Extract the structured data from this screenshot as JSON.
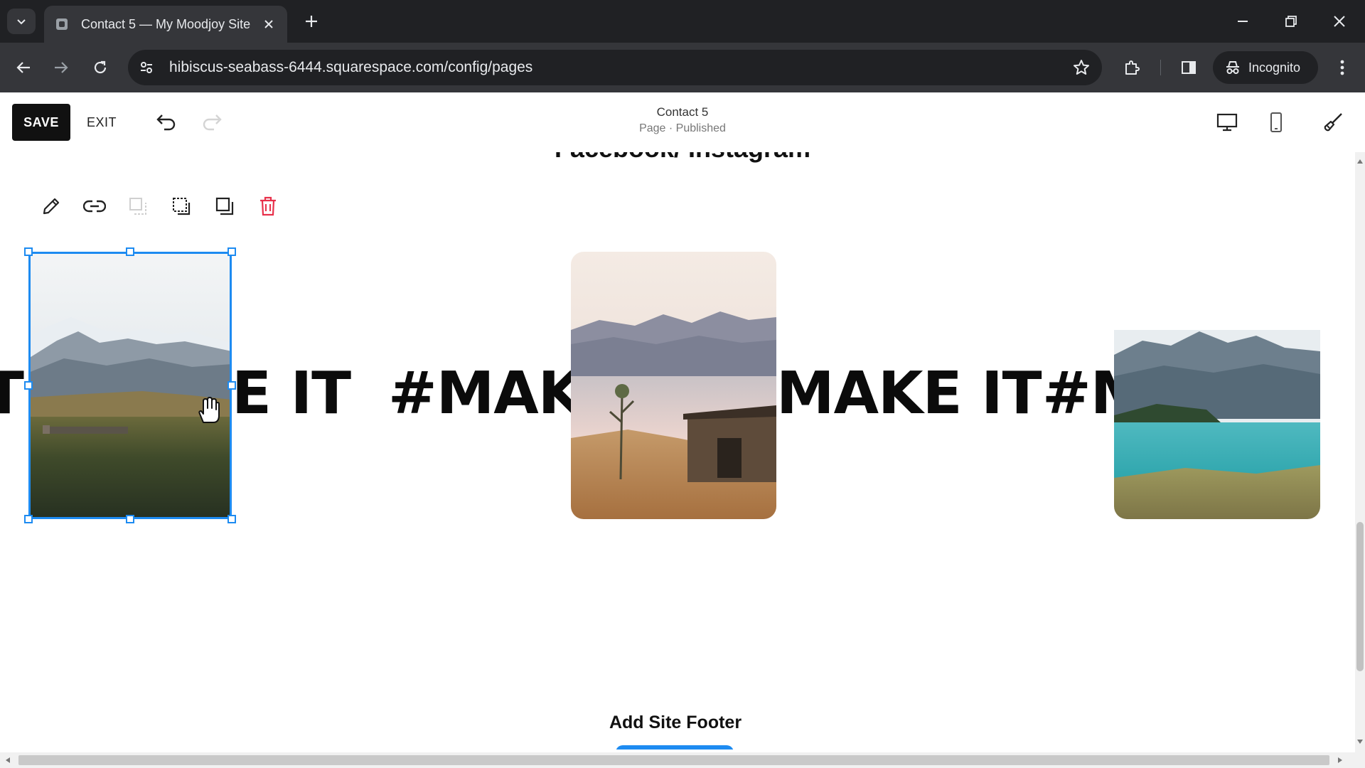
{
  "browser": {
    "tab_title": "Contact 5 — My Moodjoy Site",
    "url": "hibiscus-seabass-6444.squarespace.com/config/pages",
    "incognito_label": "Incognito"
  },
  "editor": {
    "save_label": "SAVE",
    "exit_label": "EXIT",
    "page_name": "Contact 5",
    "page_status": "Page · Published"
  },
  "canvas": {
    "cut_heading": "Facebook/ Instagram",
    "marquee_segments": [
      "T",
      "E IT",
      "#MAKE",
      "MAKE IT",
      "#M"
    ],
    "footer_label": "Add Site Footer"
  },
  "icons": {
    "block_tools": [
      "pencil-icon",
      "link-icon",
      "layer-back-icon",
      "crop-select-icon",
      "duplicate-icon",
      "trash-icon"
    ]
  },
  "colors": {
    "selection": "#1d8bf1",
    "delete": "#e8304a",
    "browser_dark": "#202124",
    "browser_toolbar": "#35363a"
  }
}
